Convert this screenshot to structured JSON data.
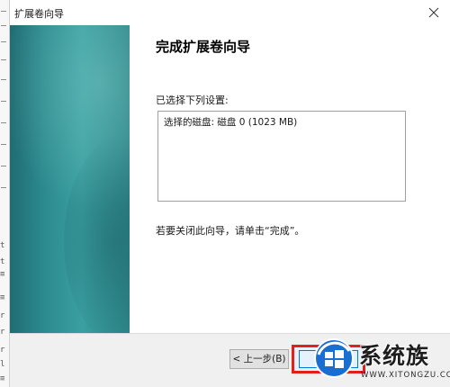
{
  "window": {
    "title": "扩展卷向导"
  },
  "page": {
    "heading": "完成扩展卷向导",
    "selected_settings_label": "已选择下列设置:",
    "settings_lines": [
      "选择的磁盘: 磁盘 0 (1023 MB)"
    ],
    "footer_note": "若要关闭此向导，请单击“完成”。"
  },
  "buttons": {
    "back_label": "< 上一步(B)",
    "finish_label": "完成"
  },
  "watermark": {
    "brand": "系统族",
    "url": "WWW.XITONGZU.COM"
  },
  "background_strip": {
    "glyphs": [
      "t",
      "t",
      "≡",
      "≡",
      "r",
      "r",
      "r",
      "l",
      "≡"
    ]
  },
  "colors": {
    "banner_teal": "#2c8a8e",
    "highlight_red": "#e0201c",
    "focus_blue": "#0078d7"
  }
}
